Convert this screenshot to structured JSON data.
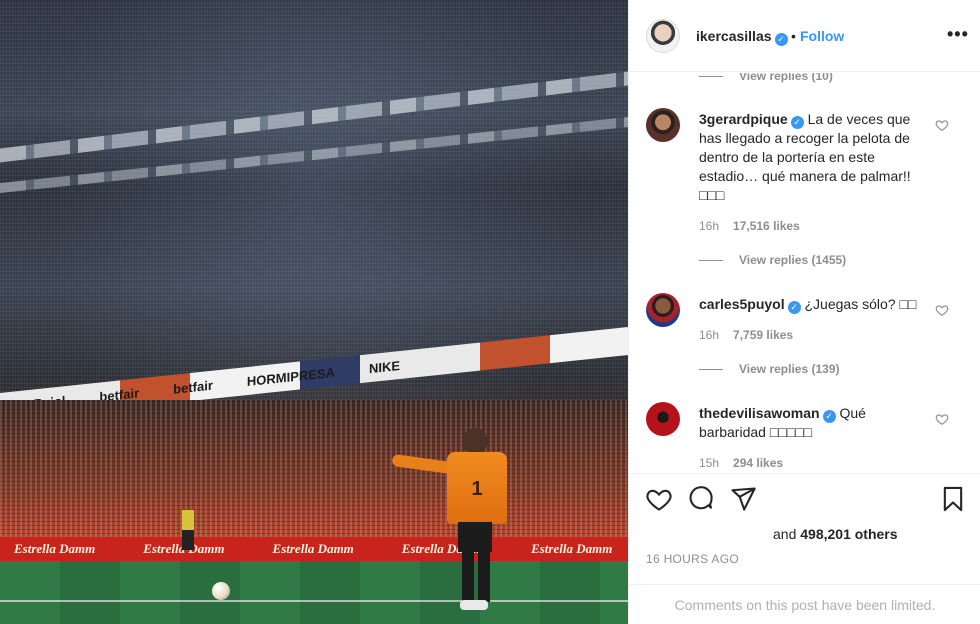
{
  "photo": {
    "ad_band": [
      "eats Pujol",
      "betfair",
      "betfair",
      "HORMIPRESA",
      "NIKE"
    ],
    "board": [
      "Estrella Damm",
      "Estrella Damm",
      "Estrella Damm",
      "Estrella Damm",
      "Estrella Damm"
    ],
    "keeper_number": "1"
  },
  "header": {
    "username": "ikercasillas",
    "dot": "•",
    "follow_label": "Follow",
    "more_label": "•••"
  },
  "comments": {
    "top_view_replies": "View replies (10)",
    "items": [
      {
        "username": "3gerardpique",
        "text": "La de veces que has llegado a recoger la pelota de dentro de la portería en este estadio… qué manera de palmar!! □□□",
        "time": "16h",
        "likes": "17,516 likes",
        "view_replies": "View replies (1455)"
      },
      {
        "username": "carles5puyol",
        "text": "¿Juegas sólo? □□",
        "time": "16h",
        "likes": "7,759 likes",
        "view_replies": "View replies (139)"
      },
      {
        "username": "thedevilisawoman",
        "text": "Qué barbaridad □□□□□",
        "time": "15h",
        "likes": "294 likes"
      }
    ]
  },
  "actions": {
    "likes_prefix": "and ",
    "likes_count": "498,201 others",
    "timestamp": "16 HOURS AGO",
    "comments_limited": "Comments on this post have been limited."
  },
  "colors": {
    "accent": "#3897f0",
    "muted": "#8e8e8e",
    "text": "#262626"
  }
}
